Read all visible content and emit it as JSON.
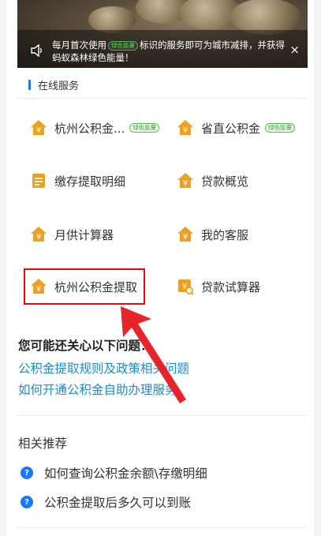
{
  "banner": {
    "notice_before": "每月首次使用",
    "tag": "绿色能量",
    "notice_after": "标识的服务即可为城市减排，并获得蚂蚁森林绿色能量！",
    "close": "×"
  },
  "section": {
    "title": "在线服务"
  },
  "services": [
    {
      "label": "杭州公积金...",
      "tag": "绿色能量",
      "icon": "yuan-house-icon"
    },
    {
      "label": "省直公积金",
      "tag": "绿色能量",
      "icon": "yuan-house-icon"
    },
    {
      "label": "缴存提取明细",
      "tag": "",
      "icon": "document-list-icon"
    },
    {
      "label": "贷款概览",
      "tag": "",
      "icon": "yuan-house-icon"
    },
    {
      "label": "月供计算器",
      "tag": "",
      "icon": "yuan-house-icon"
    },
    {
      "label": "我的客服",
      "tag": "",
      "icon": "yuan-house-icon"
    },
    {
      "label": "杭州公积金提取",
      "tag": "",
      "icon": "yuan-house-icon"
    },
    {
      "label": "贷款试算器",
      "tag": "",
      "icon": "loan-calculator-icon"
    }
  ],
  "questions": {
    "title": "您可能还关心以下问题：",
    "links": [
      "公积金提取规则及政策相关问题",
      "如何开通公积金自助办理服务"
    ]
  },
  "recommend": {
    "title": "相关推荐",
    "items": [
      "如何查询公积金余额\\存缴明细",
      "公积金提取后多久可以到账"
    ]
  },
  "colors": {
    "accent": "#1677ff",
    "highlight": "#e50b0b",
    "link": "#1a8cd8",
    "icon_orange": "#f0a020"
  }
}
